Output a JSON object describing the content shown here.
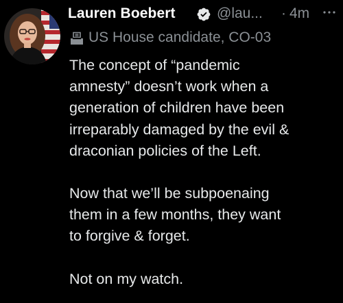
{
  "colors": {
    "background": "#000000",
    "text": "#e7e9ea",
    "secondary_text": "#8b9095",
    "verified_badge": "#e7e9ea"
  },
  "author": {
    "name": "Lauren Boebert",
    "handle": "@lau...",
    "separator": "·",
    "time": "4m",
    "verified_icon": "verified-badge-icon",
    "avatar_icon": "profile-photo"
  },
  "label": {
    "icon": "ballot-box-icon",
    "text": "US House candidate, CO-03"
  },
  "more_icon": "more-options-icon",
  "tweet": {
    "paragraphs": [
      {
        "lines": [
          "The concept of “pandemic",
          "amnesty” doesn’t work when a",
          "generation of children have been",
          "irreparably damaged by the evil &",
          "draconian policies of the Left."
        ]
      },
      {
        "lines": [
          "Now that we’ll be subpoenaing",
          "them in a few months, they want",
          "to forgive & forget."
        ]
      },
      {
        "lines": [
          "Not on my watch."
        ]
      }
    ]
  }
}
